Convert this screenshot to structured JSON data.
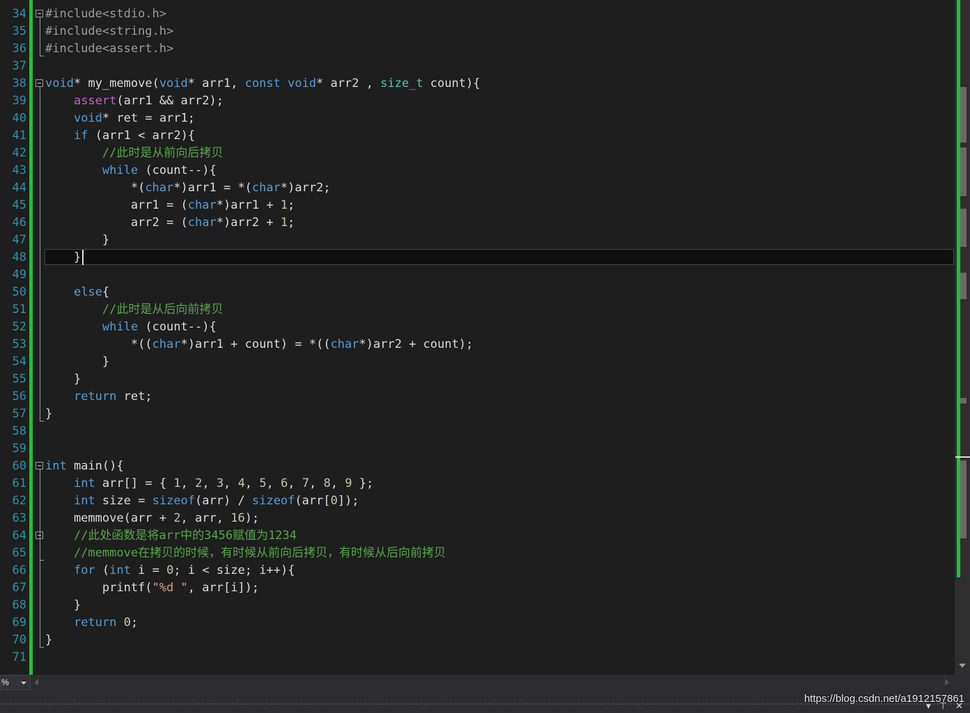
{
  "editor": {
    "lines": [
      {
        "n": "34",
        "code": "#include<stdio.h>"
      },
      {
        "n": "35",
        "code": "#include<string.h>"
      },
      {
        "n": "36",
        "code": "#include<assert.h>"
      },
      {
        "n": "37",
        "code": ""
      },
      {
        "n": "38",
        "code": "void* my_memove(void* arr1, const void* arr2 , size_t count){"
      },
      {
        "n": "39",
        "code": "    assert(arr1 && arr2);"
      },
      {
        "n": "40",
        "code": "    void* ret = arr1;"
      },
      {
        "n": "41",
        "code": "    if (arr1 < arr2){"
      },
      {
        "n": "42",
        "code": "        //此时是从前向后拷贝"
      },
      {
        "n": "43",
        "code": "        while (count--){"
      },
      {
        "n": "44",
        "code": "            *(char*)arr1 = *(char*)arr2;"
      },
      {
        "n": "45",
        "code": "            arr1 = (char*)arr1 + 1;"
      },
      {
        "n": "46",
        "code": "            arr2 = (char*)arr2 + 1;"
      },
      {
        "n": "47",
        "code": "        }"
      },
      {
        "n": "48",
        "code": "    }"
      },
      {
        "n": "49",
        "code": ""
      },
      {
        "n": "50",
        "code": "    else{"
      },
      {
        "n": "51",
        "code": "        //此时是从后向前拷贝"
      },
      {
        "n": "52",
        "code": "        while (count--){"
      },
      {
        "n": "53",
        "code": "            *((char*)arr1 + count) = *((char*)arr2 + count);"
      },
      {
        "n": "54",
        "code": "        }"
      },
      {
        "n": "55",
        "code": "    }"
      },
      {
        "n": "56",
        "code": "    return ret;"
      },
      {
        "n": "57",
        "code": "}"
      },
      {
        "n": "58",
        "code": ""
      },
      {
        "n": "59",
        "code": ""
      },
      {
        "n": "60",
        "code": "int main(){"
      },
      {
        "n": "61",
        "code": "    int arr[] = { 1, 2, 3, 4, 5, 6, 7, 8, 9 };"
      },
      {
        "n": "62",
        "code": "    int size = sizeof(arr) / sizeof(arr[0]);"
      },
      {
        "n": "63",
        "code": "    memmove(arr + 2, arr, 16);"
      },
      {
        "n": "64",
        "code": "    //此处函数是将arr中的3456赋值为1234"
      },
      {
        "n": "65",
        "code": "    //memmove在拷贝的时候，有时候从前向后拷贝，有时候从后向前拷贝"
      },
      {
        "n": "66",
        "code": "    for (int i = 0; i < size; i++){"
      },
      {
        "n": "67",
        "code": "        printf(\"%d \", arr[i]);"
      },
      {
        "n": "68",
        "code": "    }"
      },
      {
        "n": "69",
        "code": "    return 0;"
      },
      {
        "n": "70",
        "code": "}"
      },
      {
        "n": "71",
        "code": ""
      }
    ]
  },
  "status": {
    "zoom": "%"
  },
  "watermark": "https://blog.csdn.net/a1912157861",
  "colors": {
    "keyword": "#569cd6",
    "comment": "#57a64a",
    "string": "#d69d85",
    "macro": "#be63c5",
    "type": "#4ec9b0",
    "changebar": "#1fbf3a"
  }
}
